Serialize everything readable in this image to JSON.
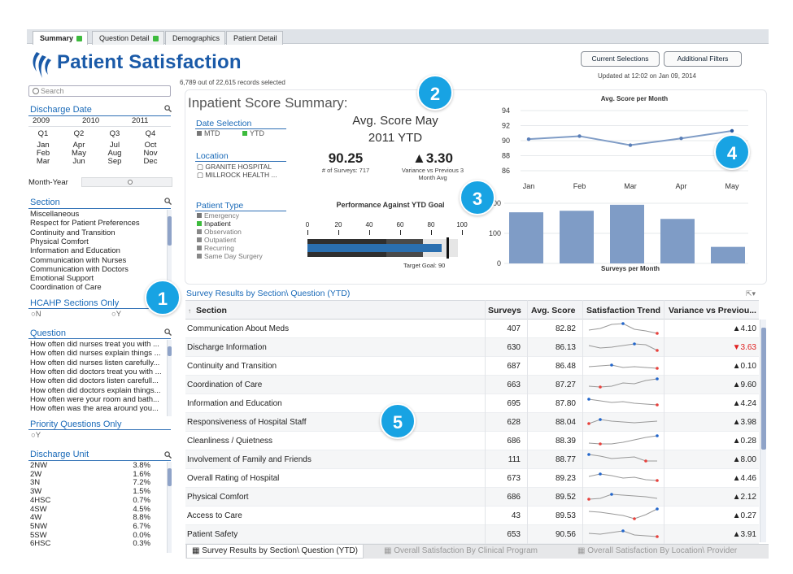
{
  "tabs": [
    {
      "label": "Summary",
      "status": "green"
    },
    {
      "label": "Question Detail",
      "status": "green"
    },
    {
      "label": "Demographics",
      "status": ""
    },
    {
      "label": "Patient Detail",
      "status": ""
    }
  ],
  "header": {
    "title": "Patient Satisfaction",
    "records": "6,789 out of 22,615 records selected",
    "current_selections": "Current Selections",
    "additional_filters": "Additional Filters",
    "updated": "Updated at 12:02 on Jan 09, 2014"
  },
  "sidebar": {
    "search_placeholder": "Search",
    "discharge_date": {
      "title": "Discharge Date",
      "years": [
        "2009",
        "2010",
        "2011"
      ],
      "quarters": [
        "Q1",
        "Q2",
        "Q3",
        "Q4"
      ],
      "months": [
        [
          "Jan",
          "Feb",
          "Mar"
        ],
        [
          "Apr",
          "May",
          "Jun"
        ],
        [
          "Jul",
          "Aug",
          "Sep"
        ],
        [
          "Oct",
          "Nov",
          "Dec"
        ]
      ],
      "slider_label": "Month-Year"
    },
    "section": {
      "title": "Section",
      "items": [
        "Miscellaneous",
        "Respect for Patient Preferences",
        "Continuity and Transition",
        "Physical Comfort",
        "Information and Education",
        "Communication with Nurses",
        "Communication with Doctors",
        "Emotional Support",
        "Coordination of Care"
      ]
    },
    "hcahp": {
      "title": "HCAHP Sections Only",
      "options": [
        "N",
        "Y"
      ]
    },
    "question": {
      "title": "Question",
      "items": [
        "How often did nurses treat you with ...",
        "How often did nurses explain things ...",
        "How often did nurses listen carefully...",
        "How often did doctors treat you with ...",
        "How often did doctors listen carefull...",
        "How often did doctors explain things...",
        "How often were your room and bath...",
        "How often was the area around you..."
      ]
    },
    "priority": {
      "title": "Priority Questions Only",
      "options": [
        "Y"
      ]
    },
    "discharge_unit": {
      "title": "Discharge Unit",
      "items": [
        [
          "2NW",
          "3.8%"
        ],
        [
          "2W",
          "1.6%"
        ],
        [
          "3N",
          "7.2%"
        ],
        [
          "3W",
          "1.5%"
        ],
        [
          "4HSC",
          "0.7%"
        ],
        [
          "4SW",
          "4.5%"
        ],
        [
          "4W",
          "8.8%"
        ],
        [
          "5NW",
          "6.7%"
        ],
        [
          "5SW",
          "0.0%"
        ],
        [
          "6HSC",
          "0.3%"
        ]
      ]
    }
  },
  "summary": {
    "title": "Inpatient Score Summary:",
    "date_selection": {
      "title": "Date Selection",
      "options": [
        "MTD",
        "YTD"
      ]
    },
    "location": {
      "title": "Location",
      "options": [
        "GRANITE HOSPITAL",
        "MILLROCK HEALTH ..."
      ]
    },
    "patient_type": {
      "title": "Patient Type",
      "options": [
        "Emergency",
        "Inpatient",
        "Observation",
        "Outpatient",
        "Recurring",
        "Same Day Surgery"
      ]
    },
    "kpi_title_line1": "Avg. Score  May",
    "kpi_title_line2": "2011 YTD",
    "avg_score": "90.25",
    "surveys_label": "# of Surveys: 717",
    "variance": "▲3.30",
    "variance_label": "Variance vs Previous 3 Month Avg",
    "bullet_title": "Performance Against YTD Goal",
    "bullet_ticks": [
      "0",
      "20",
      "40",
      "60",
      "80",
      "100"
    ],
    "target_label": "Target Goal: 90"
  },
  "chart_data": [
    {
      "type": "line",
      "title": "Avg. Score per Month",
      "categories": [
        "Jan",
        "Feb",
        "Mar",
        "Apr",
        "May"
      ],
      "values": [
        90.2,
        90.6,
        89.4,
        90.3,
        91.3
      ],
      "ylim": [
        86,
        94
      ],
      "yticks": [
        "94",
        "92",
        "90",
        "88",
        "86"
      ]
    },
    {
      "type": "bar",
      "title": "Surveys per Month",
      "categories": [
        "Jan",
        "Feb",
        "Mar",
        "Apr",
        "May"
      ],
      "values": [
        170,
        175,
        195,
        148,
        55
      ],
      "ylim": [
        0,
        200
      ],
      "yticks": [
        "200",
        "100",
        "0"
      ]
    }
  ],
  "badges": [
    "1",
    "2",
    "3",
    "4",
    "5"
  ],
  "table": {
    "title": "Survey Results by Section\\ Question (YTD)",
    "headers": [
      "Section",
      "Surveys",
      "Avg. Score",
      "Satisfaction Trend",
      "Variance vs Previou..."
    ],
    "rows": [
      [
        "Communication About Meds",
        "407",
        "82.82",
        "▲4.10",
        "up"
      ],
      [
        "Discharge Information",
        "630",
        "86.13",
        "▼3.63",
        "down"
      ],
      [
        "Continuity and Transition",
        "687",
        "86.48",
        "▲0.10",
        "up"
      ],
      [
        "Coordination of Care",
        "663",
        "87.27",
        "▲9.60",
        "up"
      ],
      [
        "Information and Education",
        "695",
        "87.80",
        "▲4.24",
        "up"
      ],
      [
        "Responsiveness of Hospital Staff",
        "628",
        "88.04",
        "▲3.98",
        "up"
      ],
      [
        "Cleanliness / Quietness",
        "686",
        "88.39",
        "▲0.28",
        "up"
      ],
      [
        "Involvement of Family and Friends",
        "111",
        "88.77",
        "▲8.00",
        "up"
      ],
      [
        "Overall Rating of Hospital",
        "673",
        "89.23",
        "▲4.46",
        "up"
      ],
      [
        "Physical Comfort",
        "686",
        "89.52",
        "▲2.12",
        "up"
      ],
      [
        "Access to Care",
        "43",
        "89.53",
        "▲0.27",
        "up"
      ],
      [
        "Patient Safety",
        "653",
        "90.56",
        "▲3.91",
        "up"
      ]
    ]
  },
  "bottom_tabs": [
    "Survey Results by Section\\ Question (YTD)",
    "Overall Satisfaction By Clinical Program",
    "Overall Satisfaction By Location\\ Provider"
  ],
  "colors": {
    "accent": "#1a5aa8",
    "bar": "#7f9cc6",
    "badge": "#18a3e3",
    "down": "#e02020",
    "dot_red": "#e8413c",
    "dot_blue": "#2266cc"
  }
}
